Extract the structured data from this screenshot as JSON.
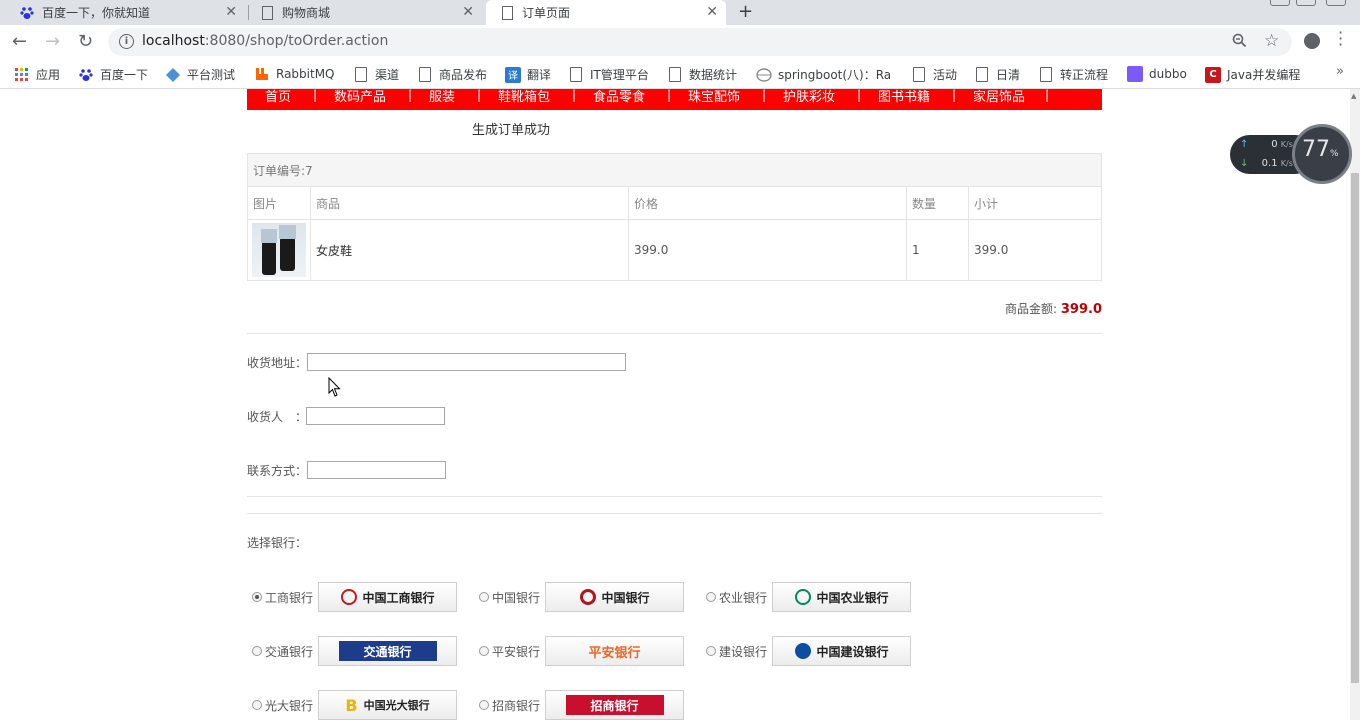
{
  "tabs": [
    {
      "title": "百度一下，你就知道",
      "close": "✕"
    },
    {
      "title": "购物商城",
      "close": "✕"
    },
    {
      "title": "订单页面",
      "close": "✕"
    }
  ],
  "new_tab": "+",
  "url": {
    "host": "localhost",
    "path": ":8080/shop/toOrder.action"
  },
  "bookmarks": [
    {
      "label": "应用"
    },
    {
      "label": "百度一下"
    },
    {
      "label": "平台测试"
    },
    {
      "label": "RabbitMQ"
    },
    {
      "label": "渠道"
    },
    {
      "label": "商品发布"
    },
    {
      "label": "翻译",
      "icon_text": "译"
    },
    {
      "label": "IT管理平台"
    },
    {
      "label": "数据统计"
    },
    {
      "label": "springboot(八)：Ra"
    },
    {
      "label": "活动"
    },
    {
      "label": "日清"
    },
    {
      "label": "转正流程"
    },
    {
      "label": "dubbo"
    },
    {
      "label": "Java并发编程",
      "icon_text": "C"
    }
  ],
  "bookmarks_more": "»",
  "nav": [
    "首页",
    "数码产品",
    "服装",
    "鞋靴箱包",
    "食品零食",
    "珠宝配饰",
    "护肤彩妆",
    "图书书籍",
    "家居饰品"
  ],
  "nav_sep": "|",
  "success_msg": "生成订单成功",
  "order": {
    "number_label": "订单编号:7",
    "columns": [
      "图片",
      "商品",
      "价格",
      "数量",
      "小计"
    ],
    "items": [
      {
        "name": "女皮鞋",
        "price": "399.0",
        "qty": "1",
        "subtotal": "399.0"
      }
    ],
    "total_label": "商品金额:",
    "total_value": "399.0"
  },
  "form": {
    "address_label": "收货地址：",
    "receiver_label": "收货人　：",
    "phone_label": "联系方式："
  },
  "bank_title": "选择银行：",
  "banks": [
    {
      "name": "工商银行",
      "logo": "中国工商银行",
      "color": "#c8161d",
      "selected": true
    },
    {
      "name": "中国银行",
      "logo": "中国银行",
      "color": "#b0161c",
      "selected": false
    },
    {
      "name": "农业银行",
      "logo": "中国农业银行",
      "color": "#008a5e",
      "selected": false
    },
    {
      "name": "交通银行",
      "logo": "交通银行",
      "color": "#1d3c8c",
      "selected": false
    },
    {
      "name": "平安银行",
      "logo": "平安银行",
      "color": "#f26522",
      "selected": false
    },
    {
      "name": "建设银行",
      "logo": "中国建设银行",
      "color": "#0b4ea2",
      "selected": false
    },
    {
      "name": "光大银行",
      "logo": "中国光大银行",
      "color": "#6a1b7c",
      "selected": false
    },
    {
      "name": "招商银行",
      "logo": "招商银行",
      "color": "#c8102e",
      "selected": false
    }
  ],
  "speed": {
    "up": "0",
    "down": "0.1",
    "unit": "K/s",
    "percent": "77",
    "pct_sign": "%"
  }
}
